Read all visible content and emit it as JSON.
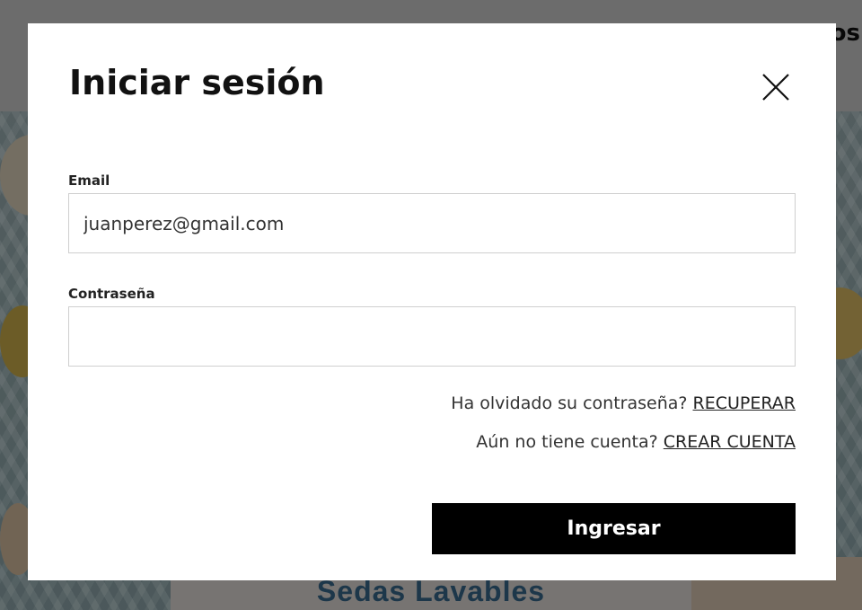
{
  "background": {
    "header_text": "os",
    "card_title": "Sedas Lavables"
  },
  "login_modal": {
    "title": "Iniciar sesión",
    "close_icon": "close-icon",
    "email": {
      "label": "Email",
      "value": "juanperez@gmail.com"
    },
    "password": {
      "label": "Contraseña",
      "value": ""
    },
    "forgot": {
      "text": "Ha olvidado su contraseña?",
      "link": "RECUPERAR"
    },
    "register": {
      "text": "Aún no tiene cuenta?",
      "link": "CREAR CUENTA"
    },
    "submit_label": "Ingresar"
  },
  "colors": {
    "button_bg": "#000000",
    "overlay": "rgba(0,0,0,0.5)"
  }
}
